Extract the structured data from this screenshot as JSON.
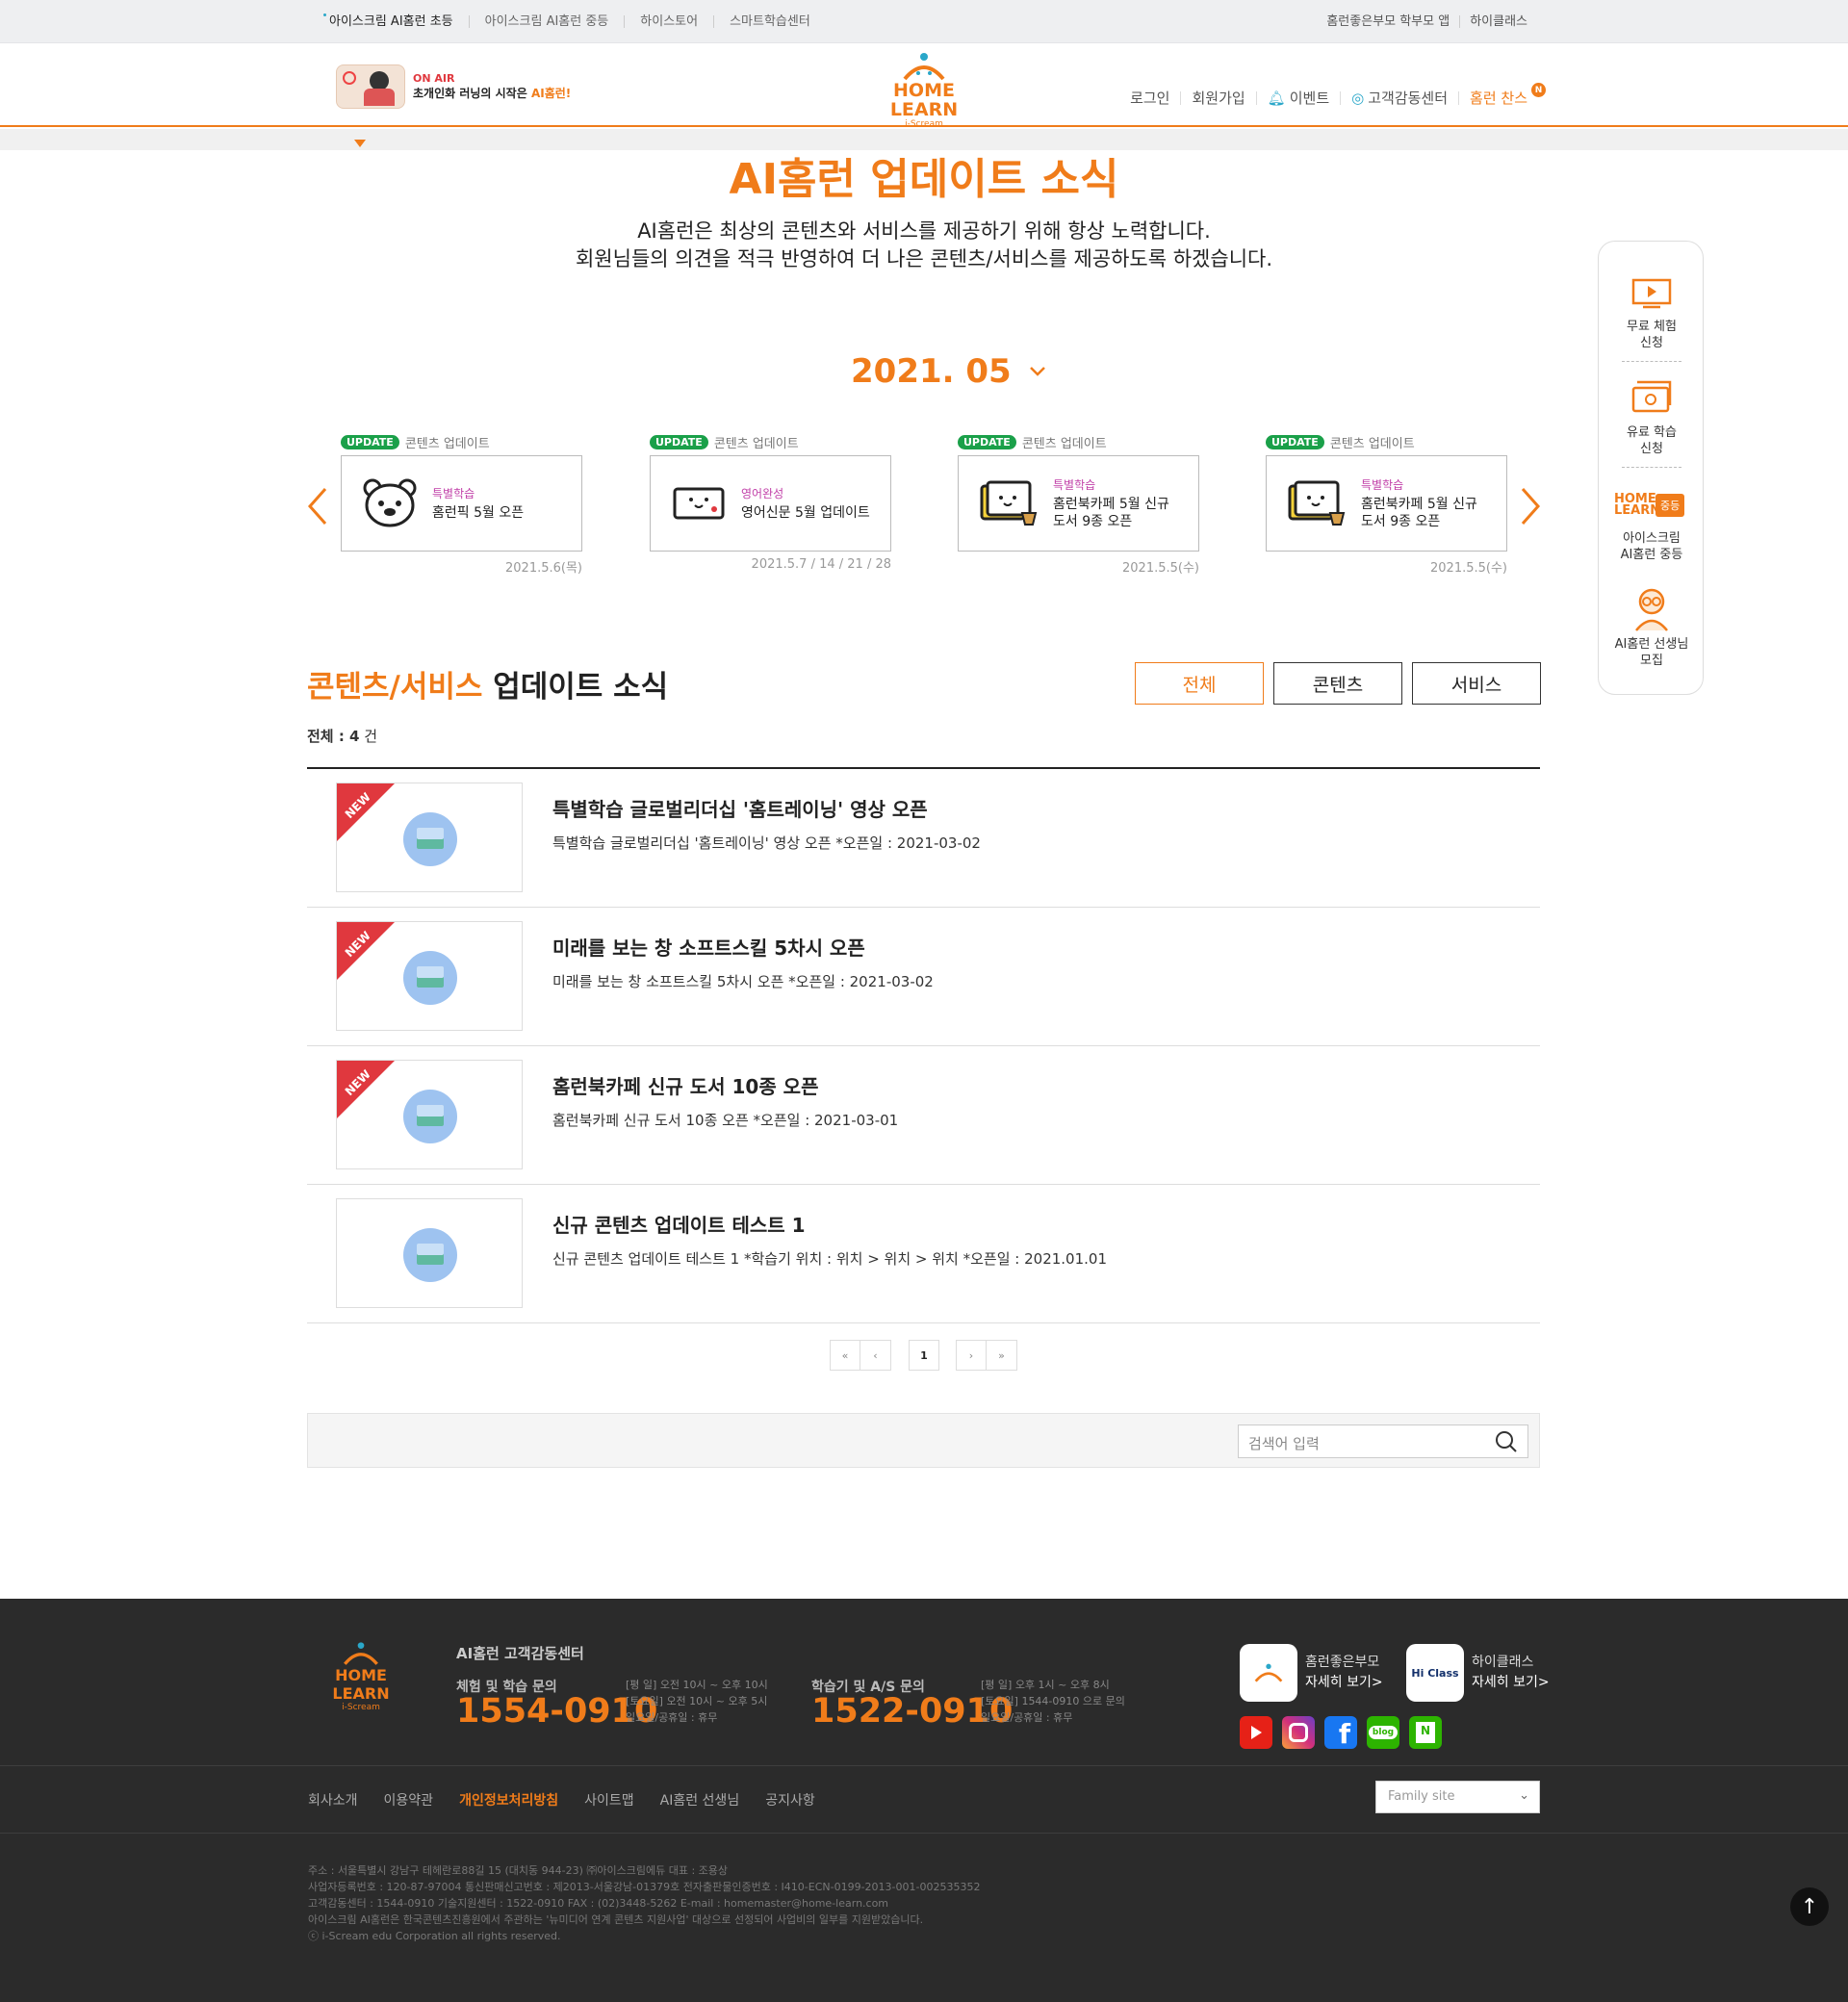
{
  "topbar": {
    "left": [
      "아이스크림 AI홈런 초등",
      "아이스크림 AI홈런 중등",
      "하이스토어",
      "스마트학습센터"
    ],
    "right": [
      "홈런좋은부모 학부모 앱",
      "하이클래스"
    ]
  },
  "header": {
    "onair": "ON AIR",
    "onair_text": "초개인화 러닝의 시작은 ",
    "onair_hl": "AI홈런!",
    "logo": "HOME LEARN",
    "logo_sub": "i-Scream",
    "nav": [
      "로그인",
      "회원가입",
      "이벤트",
      "고객감동센터",
      "홈런 찬스"
    ],
    "nav_badge": "N"
  },
  "page": {
    "title": "AI홈런 업데이트 소식",
    "intro1": "AI홈런은 최상의 콘텐츠와 서비스를 제공하기 위해 항상 노력합니다.",
    "intro2": "회원님들의 의견을 적극 반영하여 더 나은 콘텐츠/서비스를 제공하도록 하겠습니다.",
    "month": "2021. 05"
  },
  "cards": [
    {
      "badge": "UPDATE",
      "type": "콘텐츠 업데이트",
      "category": "특별학습",
      "title": "홈런픽 5월 오픈",
      "date": "2021.5.6(목)"
    },
    {
      "badge": "UPDATE",
      "type": "콘텐츠 업데이트",
      "category": "영어완성",
      "title": "영어신문 5월 업데이트",
      "date": "2021.5.7 / 14 / 21 / 28"
    },
    {
      "badge": "UPDATE",
      "type": "콘텐츠 업데이트",
      "category": "특별학습",
      "title": "홈런북카페 5월 신규 도서 9종 오픈",
      "date": "2021.5.5(수)"
    },
    {
      "badge": "UPDATE",
      "type": "콘텐츠 업데이트",
      "category": "특별학습",
      "title": "홈런북카페 5월 신규 도서 9종 오픈",
      "date": "2021.5.5(수)"
    }
  ],
  "list": {
    "heading_hl": "콘텐츠/서비스",
    "heading": " 업데이트 소식",
    "filters": [
      "전체",
      "콘텐츠",
      "서비스"
    ],
    "count_label": "전체 : ",
    "count": "4",
    "count_unit": " 건",
    "new_label": "NEW",
    "items": [
      {
        "title": "특별학습 글로벌리더십 '홈트레이닝' 영상 오픈",
        "desc": "특별학습 글로벌리더십 '홈트레이닝' 영상 오픈 *오픈일 : 2021-03-02"
      },
      {
        "title": "미래를 보는 창 소프트스킬 5차시 오픈",
        "desc": "미래를 보는 창 소프트스킬 5차시 오픈 *오픈일 : 2021-03-02"
      },
      {
        "title": "홈런북카페 신규 도서 10종 오픈",
        "desc": "홈런북카페 신규 도서 10종 오픈 *오픈일 : 2021-03-01"
      },
      {
        "title": "신규 콘텐츠 업데이트 테스트 1",
        "desc": "신규 콘텐츠 업데이트 테스트 1 *학습기 위치 : 위치 > 위치 > 위치 *오픈일 : 2021.01.01"
      }
    ],
    "page_current": "1",
    "search_placeholder": "검색어 입력"
  },
  "side": {
    "items": [
      "무료 체험\n신청",
      "유료 학습\n신청",
      "아이스크림\nAI홈런 중등",
      "AI홈런 선생님\n모집"
    ],
    "mid_badge": "중등"
  },
  "footer": {
    "center_title": "AI홈런 고객감동센터",
    "lbl1": "체험 및 학습 문의",
    "num1": "1554-0910",
    "time1": [
      "[평 일] 오전 10시 ~ 오후 10시",
      "[토요일] 오전 10시 ~ 오후 5시",
      "일요일/공휴일 : 휴무"
    ],
    "lbl2": "학습기 및 A/S 문의",
    "num2": "1522-0910",
    "time2": [
      "[평 일] 오후 1시 ~ 오후 8시",
      "[토요일] 1544-0910 으로 문의",
      "일요일/공휴일 : 휴무"
    ],
    "app1": "홈런좋은부모",
    "app1_more": "자세히 보기>",
    "app2": "하이클래스",
    "app2_more": "자세히 보기>",
    "app2_logo": "Hi Class",
    "links": [
      "회사소개",
      "이용약관",
      "개인정보처리방침",
      "사이트맵",
      "AI홈런 선생님",
      "공지사항"
    ],
    "family": "Family site",
    "addr": [
      "주소 : 서울특별시 강남구 테헤란로88길 15 (대치동 944-23) ㈜아이스크림에듀    대표 : 조용상",
      "사업자등록번호 : 120-87-97004    통신판매신고번호 : 제2013-서울강남-01379호    전자출판물인증번호 : I410-ECN-0199-2013-001-002535352",
      "고객감동센터 : 1544-0910    기술지원센터 : 1522-0910    FAX : (02)3448-5262    E-mail : homemaster@home-learn.com",
      "아이스크림 AI홈런은 한국콘텐츠진흥원에서 주관하는 '뉴미디어 연계 콘텐츠 지원사업' 대상으로 선정되어 사업비의 일부를 지원받았습니다.",
      "ⓒ i-Scream edu Corporation all rights reserved."
    ]
  },
  "colors": {
    "accent": "#f07c1a",
    "update_badge": "#1aa049",
    "new_ribbon": "#e0383e",
    "footer_bg": "#2b2b2b"
  }
}
